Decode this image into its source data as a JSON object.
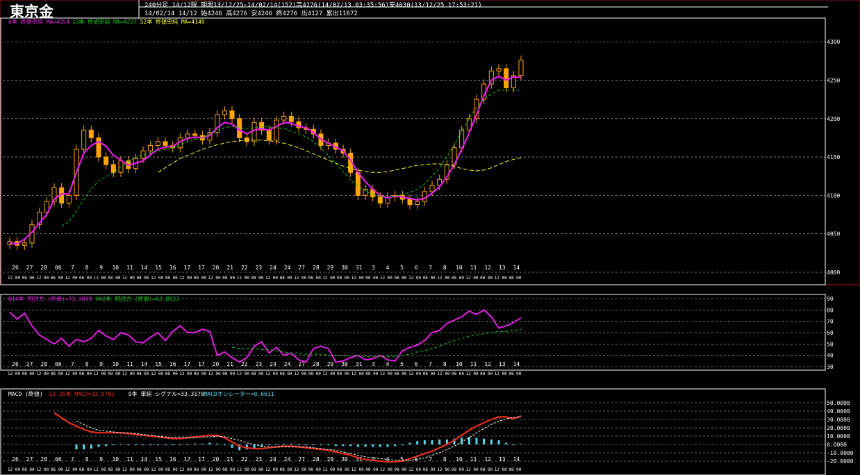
{
  "header": {
    "symbol": "東京金",
    "line1": "240分足 14/12限 期間13/12/25~14/02/14(152)高4276(14/02/13 03:35:56)安4030(13/12/25 17:53:21)",
    "line2": "14/02/14 14/12 始4246 高4276 安4246 終4276 出4127 累出11672"
  },
  "colors": {
    "ma6": "#e61ee6",
    "ma13": "#14c814",
    "ma52": "#ffff32",
    "candle": "#ffa500",
    "macd": "#e62d1e",
    "signal": "#ffffff",
    "histogram": "#50dcf0",
    "grid": "#c8c8c8",
    "axis": "#ffffff"
  },
  "date_labels": [
    "26",
    "27",
    "28",
    "06",
    "7",
    "8",
    "9",
    "10",
    "11",
    "14",
    "15",
    "16",
    "17",
    "17",
    "20",
    "21",
    "22",
    "23",
    "24",
    "24",
    "27",
    "28",
    "29",
    "30",
    "31",
    "3",
    "4",
    "5",
    "6",
    "7",
    "8",
    "10",
    "11",
    "12",
    "13",
    "14"
  ],
  "time_codes": [
    "12 00",
    "08 00",
    "12 00",
    "08 00",
    "12 00",
    "08 00",
    "12 00",
    "08 00",
    "12 00",
    "08 00",
    "12 00",
    "08 00",
    "12 00",
    "08 00",
    "12 00",
    "08 00",
    "12 00",
    "08 00",
    "12 00",
    "08 00",
    "12 00",
    "08 00",
    "12 00",
    "08 00",
    "12 00",
    "08 00",
    "12 00",
    "08 00",
    "12 00",
    "08 00",
    "12 00",
    "08 00",
    "12 00",
    "08 00",
    "12 00",
    "08 00"
  ],
  "chart_data": [
    {
      "type": "candlestick",
      "legend": [
        {
          "text": "6本 終値単純 MA=4254",
          "color": "#e61ee6"
        },
        {
          "text": "13本 終値単純 MA=4237",
          "color": "#14c814"
        },
        {
          "text": "52本 終値単純 MA=4149",
          "color": "#ffff32"
        }
      ],
      "ylim": [
        4000,
        4320
      ],
      "yticks": [
        4000,
        4050,
        4100,
        4150,
        4200,
        4250,
        4300
      ],
      "close": [
        4040,
        4035,
        4038,
        4062,
        4078,
        4092,
        4110,
        4090,
        4100,
        4160,
        4185,
        4175,
        4150,
        4140,
        4130,
        4145,
        4135,
        4148,
        4158,
        4165,
        4170,
        4165,
        4162,
        4175,
        4180,
        4178,
        4172,
        4182,
        4205,
        4210,
        4200,
        4175,
        4170,
        4195,
        4185,
        4172,
        4198,
        4203,
        4196,
        4188,
        4186,
        4180,
        4165,
        4168,
        4160,
        4155,
        4130,
        4100,
        4108,
        4098,
        4090,
        4098,
        4100,
        4095,
        4088,
        4092,
        4105,
        4113,
        4121,
        4140,
        4162,
        4185,
        4200,
        4225,
        4245,
        4262,
        4265,
        4240,
        4256,
        4276
      ],
      "series": [
        {
          "name": "6本 終値単純 MA=4254",
          "values": [
            4038,
            4037,
            4043,
            4052,
            4064,
            4075,
            4095,
            4102,
            4102,
            4130,
            4155,
            4165,
            4170,
            4164,
            4152,
            4146,
            4139,
            4142,
            4145,
            4153,
            4160,
            4163,
            4164,
            4170,
            4174,
            4176,
            4175,
            4178,
            4188,
            4195,
            4193,
            4185,
            4180,
            4185,
            4187,
            4185,
            4190,
            4195,
            4194,
            4190,
            4188,
            4182,
            4173,
            4168,
            4163,
            4158,
            4146,
            4130,
            4118,
            4108,
            4100,
            4097,
            4099,
            4098,
            4096,
            4094,
            4096,
            4103,
            4111,
            4124,
            4140,
            4160,
            4181,
            4205,
            4230,
            4250,
            4255,
            4250,
            4254,
            4254
          ]
        },
        {
          "name": "13本 終値単純 MA=4237",
          "values": [
            null,
            null,
            null,
            null,
            null,
            null,
            null,
            4060,
            4066,
            4080,
            4095,
            4108,
            4119,
            4124,
            4130,
            4137,
            4144,
            4150,
            4152,
            4156,
            4158,
            4160,
            4162,
            4166,
            4170,
            4173,
            4175,
            4180,
            4185,
            4188,
            4190,
            4188,
            4187,
            4188,
            4190,
            4189,
            4188,
            4187,
            4184,
            4180,
            4176,
            4170,
            4162,
            4152,
            4142,
            4131,
            4120,
            4112,
            4106,
            4101,
            4099,
            4098,
            4099,
            4101,
            4104,
            4108,
            4115,
            4125,
            4136,
            4150,
            4166,
            4183,
            4200,
            4215,
            4225,
            4232,
            4237,
            4237,
            4237,
            4237
          ]
        },
        {
          "name": "52本 終値単純 MA=4149",
          "values": [
            null,
            null,
            null,
            null,
            null,
            null,
            null,
            null,
            null,
            null,
            null,
            null,
            null,
            null,
            null,
            null,
            null,
            null,
            null,
            null,
            4130,
            4136,
            4142,
            4148,
            4152,
            4156,
            4160,
            4163,
            4166,
            4168,
            4170,
            4171,
            4172,
            4172,
            4172,
            4171,
            4170,
            4168,
            4165,
            4162,
            4158,
            4154,
            4150,
            4146,
            4142,
            4138,
            4135,
            4133,
            4131,
            4130,
            4130,
            4131,
            4133,
            4135,
            4137,
            4139,
            4140,
            4141,
            4141,
            4140,
            4138,
            4135,
            4133,
            4132,
            4133,
            4136,
            4140,
            4144,
            4147,
            4149
          ]
        }
      ]
    },
    {
      "type": "line",
      "legend": [
        {
          "text": "014本 相対力 (終値)=73.3899",
          "color": "#e61ee6"
        },
        {
          "text": "042本 相対力 (終値)=62.8923",
          "color": "#14c814"
        }
      ],
      "ylim": [
        30,
        90
      ],
      "yticks": [
        30,
        40,
        50,
        60,
        70,
        80,
        90
      ],
      "series": [
        {
          "name": "014本 相対力 (終値)=73.3899",
          "values": [
            78,
            72,
            77,
            66,
            58,
            54,
            50,
            55,
            48,
            54,
            52,
            55,
            62,
            57,
            54,
            60,
            58,
            52,
            51,
            56,
            60,
            53,
            61,
            66,
            60,
            60,
            63,
            61,
            40,
            43,
            38,
            34,
            38,
            48,
            52,
            42,
            47,
            40,
            42,
            36,
            34,
            46,
            48,
            46,
            34,
            35,
            38,
            40,
            36,
            37,
            40,
            36,
            35,
            44,
            47,
            49,
            53,
            60,
            62,
            68,
            71,
            74,
            79,
            76,
            80,
            74,
            64,
            66,
            69,
            73
          ]
        },
        {
          "name": "042本 相対力 (終値)=62.8923",
          "values": [
            null,
            null,
            null,
            null,
            null,
            null,
            null,
            null,
            null,
            null,
            null,
            null,
            null,
            null,
            null,
            null,
            null,
            null,
            null,
            null,
            null,
            null,
            null,
            null,
            null,
            null,
            null,
            null,
            null,
            null,
            47,
            46,
            46,
            46,
            45,
            45,
            44,
            43,
            42,
            42,
            41,
            41,
            41,
            40,
            40,
            40,
            40,
            40,
            39,
            39,
            39,
            39,
            39,
            40,
            41,
            43,
            44,
            46,
            48,
            51,
            53,
            55,
            57,
            58,
            59,
            60,
            61,
            61,
            62,
            62.9
          ]
        }
      ]
    },
    {
      "type": "line",
      "legend": [
        {
          "text": "MACD (終値)",
          "color": "#ffffff"
        },
        {
          "text": "12-26本 MACD=33.9781",
          "color": "#e62d1e"
        },
        {
          "text": "9本 単純 シグナル=33.3170",
          "color": "#ffffff"
        },
        {
          "text": "MACDオシレーター=0.6611",
          "color": "#50dcf0"
        }
      ],
      "ylim": [
        -20,
        50
      ],
      "yticks": [
        -20,
        -10,
        0,
        10,
        20,
        30,
        40,
        50
      ],
      "series": [
        {
          "name": "12-26本 MACD=33.9781",
          "values": [
            null,
            null,
            null,
            null,
            null,
            null,
            38,
            32,
            26,
            22,
            18,
            15,
            14,
            14,
            14,
            14,
            13,
            12,
            11,
            10,
            9,
            8,
            7,
            7,
            8,
            9,
            10,
            11,
            11,
            8,
            3,
            -2,
            -4,
            -5,
            -5,
            -4,
            -3,
            -2,
            -2,
            -3,
            -4,
            -5,
            -6,
            -7,
            -9,
            -11,
            -13,
            -16,
            -18,
            -19,
            -20,
            -21,
            -21,
            -20,
            -17,
            -14,
            -11,
            -8,
            -4,
            0,
            5,
            11,
            17,
            22,
            26,
            30,
            33,
            33,
            31,
            34
          ]
        },
        {
          "name": "9本 単純 シグナル=33.3170",
          "values": [
            null,
            null,
            null,
            null,
            null,
            null,
            null,
            null,
            null,
            28,
            24,
            20,
            17,
            16,
            15,
            14,
            14,
            13,
            12,
            11,
            10,
            9,
            8,
            8,
            8,
            8,
            9,
            9,
            10,
            9,
            7,
            5,
            2,
            0,
            -2,
            -3,
            -3,
            -3,
            -3,
            -3,
            -3,
            -4,
            -5,
            -6,
            -7,
            -9,
            -11,
            -13,
            -15,
            -16,
            -17,
            -18,
            -19,
            -19,
            -19,
            -18,
            -16,
            -13,
            -10,
            -6,
            -2,
            3,
            8,
            14,
            19,
            24,
            28,
            31,
            32,
            33.3
          ]
        },
        {
          "name": "MACDオシレーター=0.6611",
          "values": [
            null,
            null,
            null,
            null,
            null,
            null,
            null,
            null,
            null,
            -6,
            -6,
            -5,
            -3,
            -2,
            -1,
            0,
            -1,
            -1,
            -1,
            -1,
            -1,
            -1,
            -1,
            -1,
            0,
            1,
            1,
            2,
            1,
            -1,
            -4,
            -7,
            -6,
            -5,
            -3,
            -1,
            0,
            1,
            1,
            0,
            -1,
            -1,
            -1,
            -1,
            -2,
            -2,
            -2,
            -3,
            -3,
            -3,
            -3,
            -3,
            -2,
            -1,
            2,
            4,
            5,
            5,
            6,
            6,
            7,
            8,
            9,
            8,
            7,
            6,
            5,
            2,
            -1,
            0.66
          ]
        }
      ]
    }
  ]
}
